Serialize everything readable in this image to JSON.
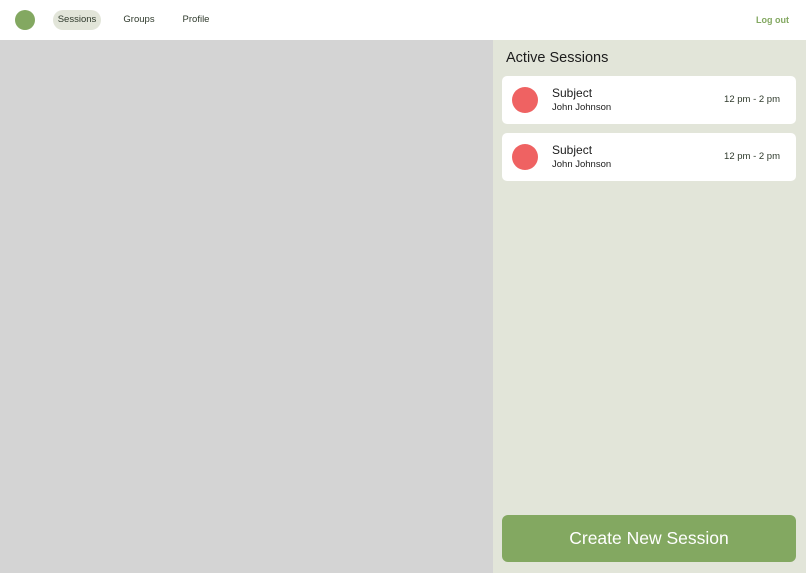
{
  "colors": {
    "brand": "#83a861",
    "accent_soft": "#e2e5d9",
    "session_dot": "#ef6262",
    "map_background": "#d4d4d4"
  },
  "header": {
    "logo_icon": "circle-logo-icon",
    "nav": [
      {
        "label": "Sessions",
        "active": true
      },
      {
        "label": "Groups",
        "active": false
      },
      {
        "label": "Profile",
        "active": false
      }
    ],
    "logout_label": "Log out"
  },
  "panel": {
    "title": "Active Sessions",
    "sessions": [
      {
        "subject": "Subject",
        "tutor": "John Johnson",
        "time": "12 pm - 2 pm",
        "icon": "red-circle-icon"
      },
      {
        "subject": "Subject",
        "tutor": "John Johnson",
        "time": "12 pm - 2 pm",
        "icon": "red-circle-icon"
      }
    ],
    "create_button_label": "Create New Session"
  }
}
